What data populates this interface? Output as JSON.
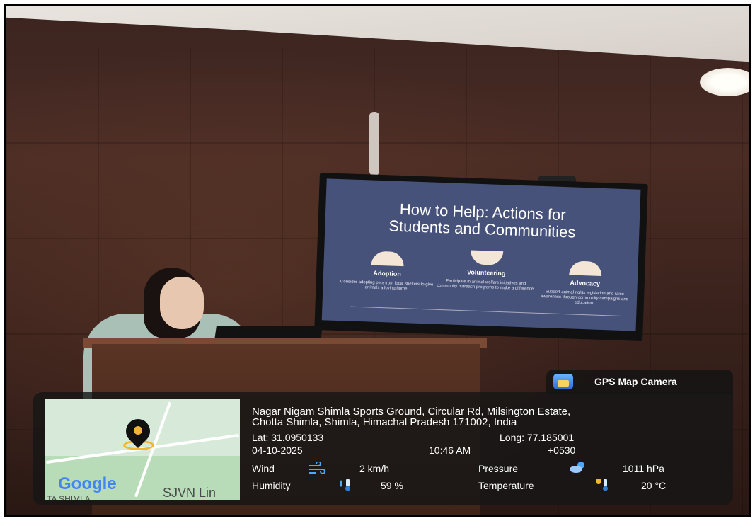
{
  "slide": {
    "title_line1": "How to Help: Actions for",
    "title_line2": "Students and Communities",
    "columns": [
      {
        "heading": "Adoption",
        "body": "Consider adopting pets from local shelters to give animals a loving home."
      },
      {
        "heading": "Volunteering",
        "body": "Participate in animal welfare initiatives and community outreach programs to make a difference."
      },
      {
        "heading": "Advocacy",
        "body": "Support animal rights legislation and raise awareness through community campaigns and education."
      }
    ]
  },
  "gps": {
    "app_title": "GPS Map Camera",
    "address_line1": "Nagar Nigam Shimla Sports Ground, Circular Rd, Milsington Estate,",
    "address_line2": "Chotta Shimla, Shimla, Himachal Pradesh 171002, India",
    "lat": "Lat: 31.0950133",
    "long": "Long: 77.185001",
    "date": "04-10-2025",
    "time": "10:46 AM",
    "tz": "+0530",
    "wind_label": "Wind",
    "wind_value": "2 km/h",
    "humidity_label": "Humidity",
    "humidity_value": "59 %",
    "pressure_label": "Pressure",
    "pressure_value": "1011 hPa",
    "temperature_label": "Temperature",
    "temperature_value": "20 °C",
    "map_brand": "Google",
    "map_label": "SJVN Lin",
    "map_label2": "TA SHIMLA"
  },
  "icons": {
    "wind": "wind-icon",
    "humidity": "humidity-thermometer-icon",
    "pressure": "weather-cloud-icon",
    "temperature": "sun-thermometer-icon",
    "pin": "map-pin-icon"
  },
  "colors": {
    "overlay_bg": "#161616",
    "pin_accent": "#f2b632",
    "slide_bg": "#46527a"
  }
}
